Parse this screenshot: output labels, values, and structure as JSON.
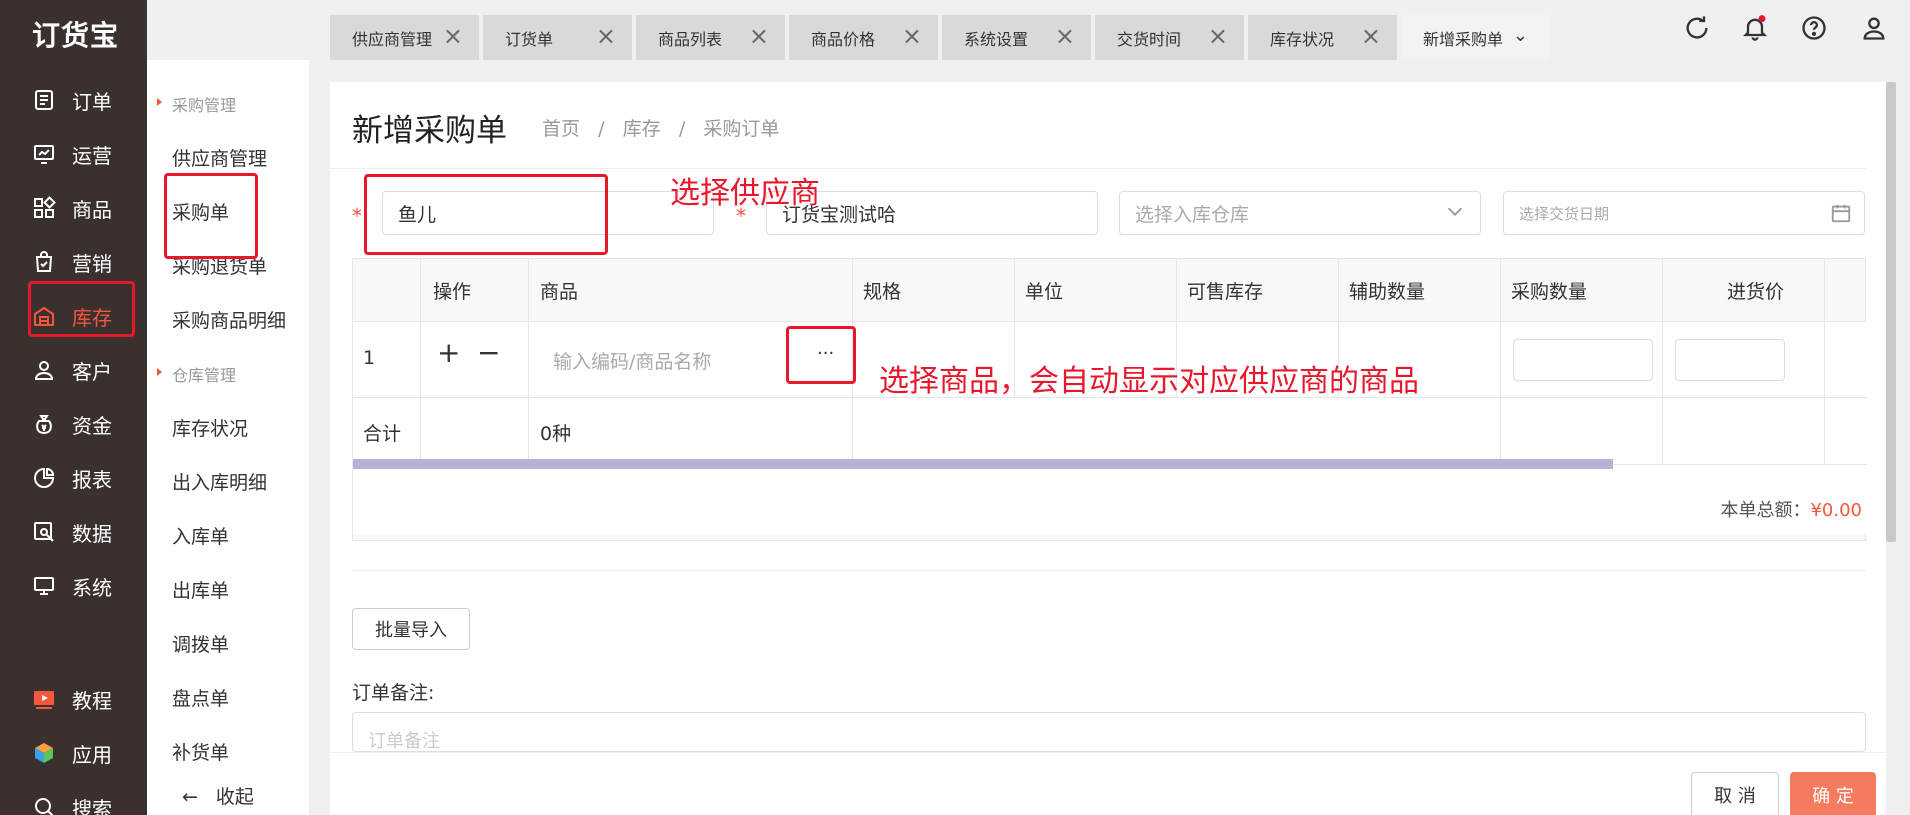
{
  "brand": {
    "logo": "订货宝"
  },
  "nav": [
    {
      "label": "订单",
      "icon": "order-icon"
    },
    {
      "label": "运营",
      "icon": "chart-board-icon"
    },
    {
      "label": "商品",
      "icon": "grid-icon"
    },
    {
      "label": "营销",
      "icon": "bag-icon"
    },
    {
      "label": "库存",
      "icon": "warehouse-icon"
    },
    {
      "label": "客户",
      "icon": "user-icon"
    },
    {
      "label": "资金",
      "icon": "money-bag-icon"
    },
    {
      "label": "报表",
      "icon": "pie-chart-icon"
    },
    {
      "label": "数据",
      "icon": "data-search-icon"
    },
    {
      "label": "系统",
      "icon": "monitor-icon"
    }
  ],
  "nav_bottom": [
    {
      "label": "教程",
      "icon": "video-play-icon"
    },
    {
      "label": "应用",
      "icon": "cube-icon"
    },
    {
      "label": "搜索",
      "icon": "search-icon"
    }
  ],
  "submenu": {
    "group1": "采购管理",
    "group1_items": [
      "供应商管理",
      "采购单",
      "采购退货单",
      "采购商品明细"
    ],
    "group2": "仓库管理",
    "group2_items": [
      "库存状况",
      "出入库明细",
      "入库单",
      "出库单",
      "调拨单",
      "盘点单",
      "补货单"
    ],
    "collapse": "收起",
    "collapse_icon": "arrow-left-icon"
  },
  "tabs": [
    {
      "label": "供应商管理"
    },
    {
      "label": "订货单"
    },
    {
      "label": "商品列表"
    },
    {
      "label": "商品价格"
    },
    {
      "label": "系统设置"
    },
    {
      "label": "交货时间"
    },
    {
      "label": "库存状况"
    },
    {
      "label": "新增采购单"
    }
  ],
  "topbar_icons": [
    "refresh-icon",
    "bell-icon",
    "help-icon",
    "user-icon"
  ],
  "page": {
    "title": "新增采购单",
    "breadcrumb": [
      "首页",
      "库存",
      "采购订单"
    ]
  },
  "form": {
    "supplier_value": "鱼儿",
    "store_value": "订货宝测试哈",
    "warehouse_placeholder": "选择入库仓库",
    "date_placeholder": "选择交货日期"
  },
  "table": {
    "headers": [
      "操作",
      "商品",
      "规格",
      "单位",
      "可售库存",
      "辅助数量",
      "采购数量",
      "进货价"
    ],
    "row_index": "1",
    "product_placeholder": "输入编码/商品名称",
    "more_button": "···",
    "sum_label": "合计",
    "sum_kinds": "0种",
    "total_label": "本单总额：",
    "total_amount": "¥0.00"
  },
  "actions": {
    "batch_import": "批量导入",
    "remark_label": "订单备注:",
    "remark_placeholder": "订单备注",
    "cancel": "取 消",
    "confirm": "确 定"
  },
  "annotations": {
    "supplier_note": "选择供应商",
    "product_note": "选择商品，会自动显示对应供应商的商品"
  }
}
